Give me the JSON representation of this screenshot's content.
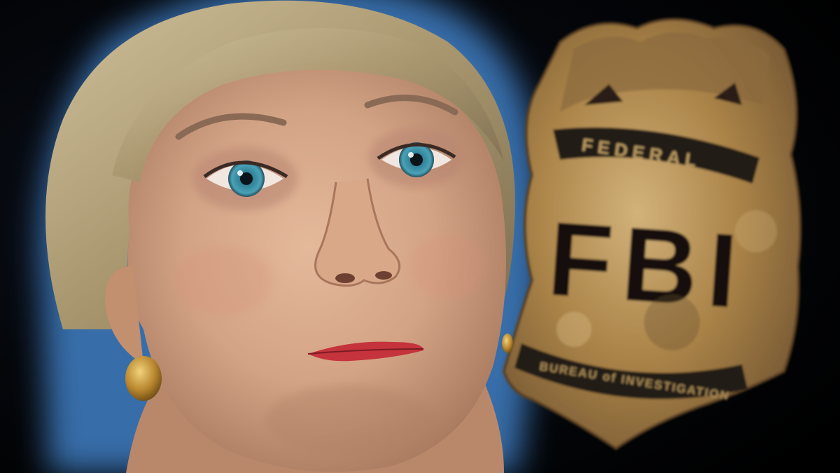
{
  "image": {
    "description_free": true,
    "colors": {
      "background": "#030406",
      "glow": "#4f8fd6",
      "skin": "#d6a98a",
      "hair": "#b9a77e",
      "iris": "#3e8fa6",
      "lips": "#c5333c",
      "badge_gold": "#b58a4a",
      "badge_dark": "#241c12"
    },
    "icons": [
      "portrait",
      "fbi-badge"
    ]
  },
  "badge": {
    "top_word": "FEDERAL",
    "center_word": "FBI",
    "bottom_words": "BUREAU of INVESTIGATION"
  }
}
